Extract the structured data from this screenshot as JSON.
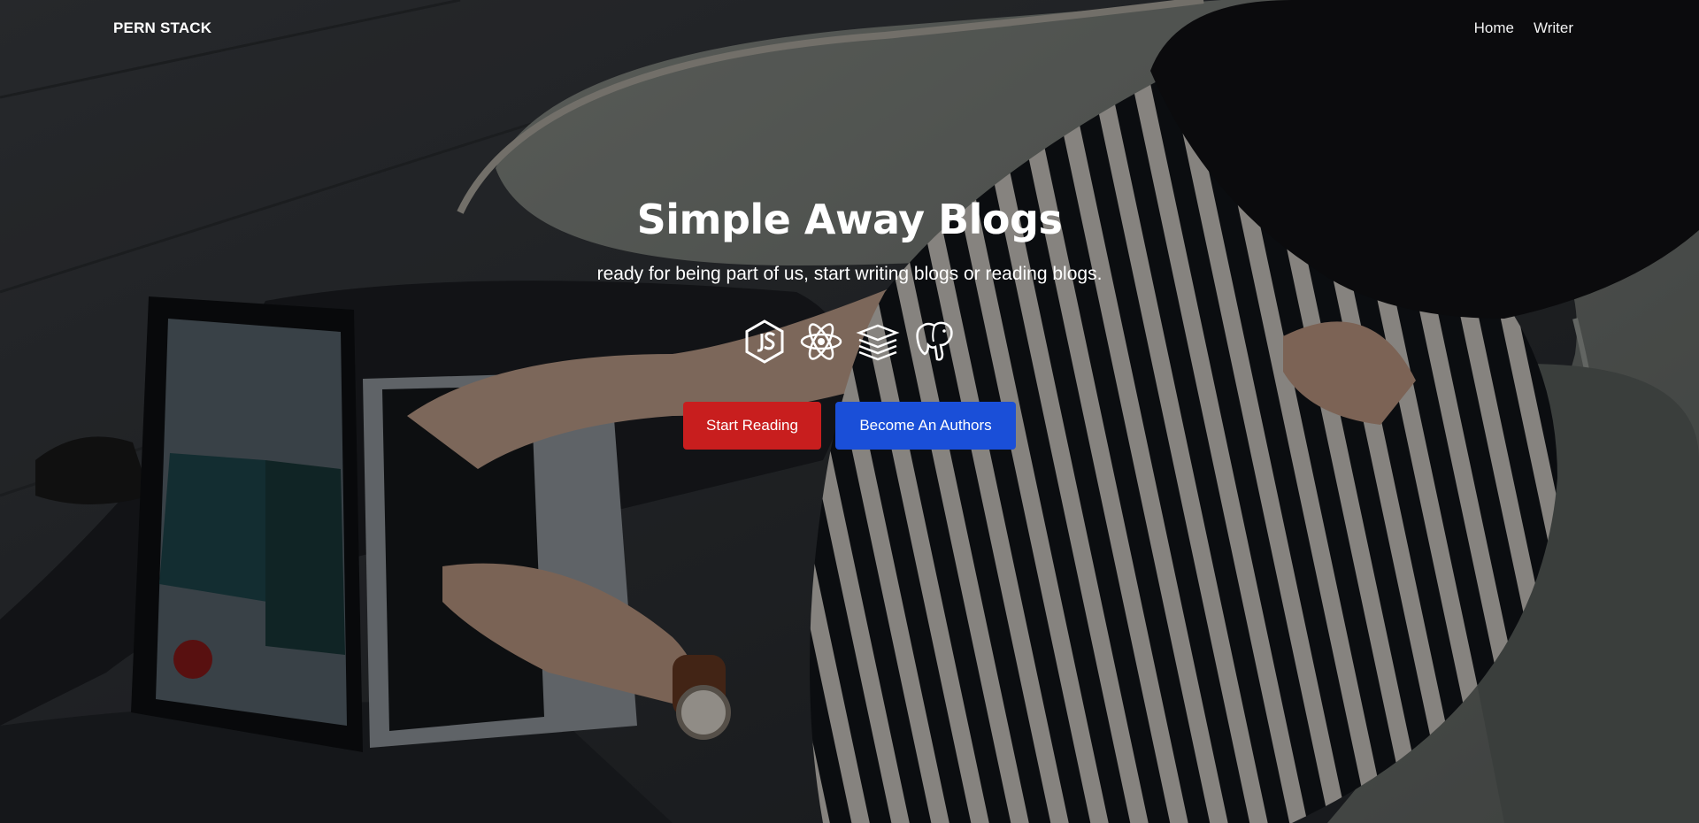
{
  "nav": {
    "brand": "PERN STACK",
    "links": [
      "Home",
      "Writer"
    ]
  },
  "hero": {
    "title": "Simple Away Blogs",
    "subtitle": "ready for being part of us, start writing blogs or reading blogs.",
    "tech_icons": [
      "nodejs-icon",
      "react-icon",
      "sequelize-stack-icon",
      "postgresql-elephant-icon"
    ],
    "buttons": {
      "start_reading": "Start Reading",
      "become_author": "Become An Authors"
    }
  },
  "colors": {
    "primary_red": "#c81e1e",
    "primary_blue": "#1a4fd8",
    "text_white": "#ffffff"
  }
}
